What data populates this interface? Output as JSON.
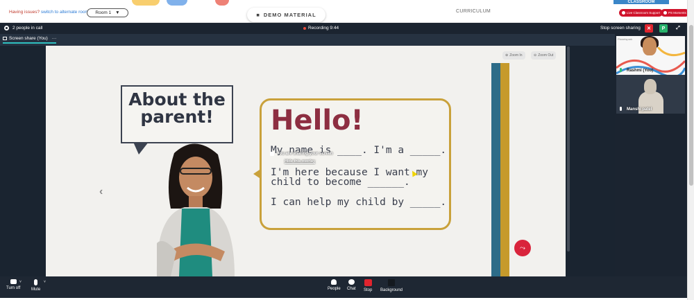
{
  "header": {
    "issues_text": "Having issues?",
    "switch_link": "switch to alternate room",
    "room_select": "Room 1",
    "demo_button": "DEMO MATERIAL",
    "curriculum": "CURRICULUM",
    "classroom_tab": "CLASSROOM",
    "support_pill": "Live Classroom Support",
    "moments_pill": "PS Moments"
  },
  "call": {
    "people_count": "2 people in call",
    "recording": "Recording 9:44",
    "stop_sharing": "Stop screen sharing",
    "close_btn": "✕",
    "p_btn": "P",
    "share_tab": "Screen share (You)",
    "share_tab_more": "···"
  },
  "slide": {
    "zoom_in": "Zoom In",
    "zoom_out": "Zoom Out",
    "about_title": "About the parent!",
    "hello": "Hello!",
    "line1": "My name is ____. I'm a _____.",
    "line2": "I'm here because I want my child to become ______.",
    "line3": "I can help my child by _____.",
    "overlay_text": "You are sharing your screen",
    "overlay_link": "Hide this overlay",
    "nav_prev": "‹",
    "nav_next": "›"
  },
  "tiles": [
    {
      "name": "Rashmi (You)",
      "brand": "Planetspark"
    },
    {
      "name": "Manshi patel"
    }
  ],
  "toolbar": {
    "turn_off": "Turn off",
    "mute": "Mute",
    "people": "People",
    "chat": "Chat",
    "stop": "Stop",
    "background": "Background"
  },
  "colors": {
    "accent_red": "#d0142c",
    "call_bg": "#1b2430",
    "hello_color": "#8d2e41",
    "box_gold": "#c9a13a"
  }
}
